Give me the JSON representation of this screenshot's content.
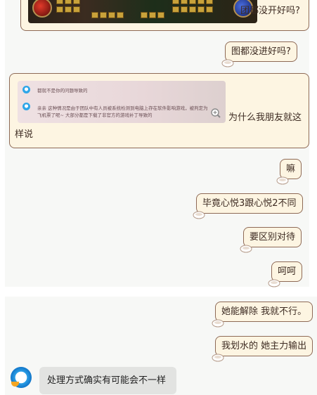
{
  "chat": {
    "game_caption": "团都没开好吗?",
    "quote_preview": {
      "line1": "都就不是你的问题导致的",
      "line2": "亲亲 这种情况是由于团队中有人员被系统检测到电脑上存在软件影响游戏，被判定为飞机票了呢~ 大部分都是下载了非官方的游戏补丁导致的"
    },
    "quote_caption_a": "为什么我朋友就这",
    "quote_caption_b": "样说",
    "messages_top": [
      "图都没进好吗?",
      "嘛",
      "毕竟心悦3跟心悦2不同",
      "要区别对待",
      "呵呵"
    ],
    "messages_bottom": [
      "她能解除 我就不行。",
      "我划水的 她主力输出"
    ],
    "reply": "处理方式确实有可能会不一样"
  },
  "icons": {
    "tea_cup": "tea-cup-icon",
    "zoom": "zoom-in-icon",
    "service_avatar": "qq-service-avatar-icon"
  },
  "colors": {
    "bubble_fill": "#fdf5e2",
    "bubble_border": "#8e6a56",
    "panel_bg": "#f7f8f6",
    "reply_bg": "#e2e3e1"
  }
}
